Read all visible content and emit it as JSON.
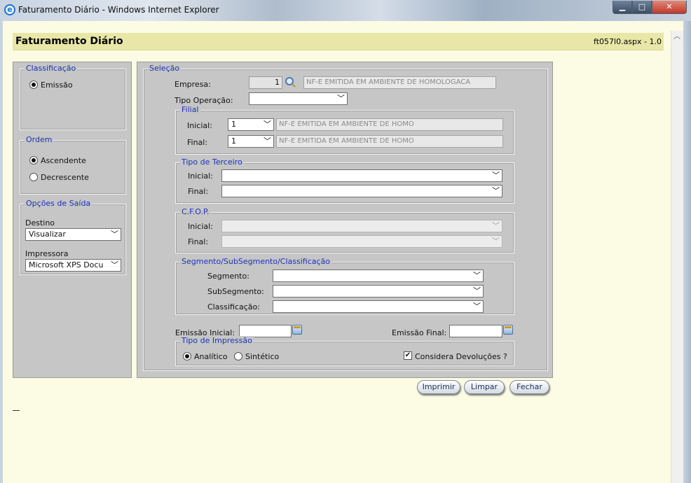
{
  "window": {
    "title": "Faturamento Diário - Windows Internet Explorer",
    "minimize": "▁",
    "maximize": "□",
    "close": "✕"
  },
  "header": {
    "title": "Faturamento Diário",
    "version": "ft057l0.aspx - 1.0"
  },
  "classificacao": {
    "legend": "Classificação",
    "option": "Emissão"
  },
  "ordem": {
    "legend": "Ordem",
    "asc": "Ascendente",
    "desc": "Decrescente"
  },
  "saida": {
    "legend": "Opções de Saída",
    "destino_label": "Destino",
    "destino_value": "Visualizar",
    "impressora_label": "Impressora",
    "impressora_value": "Microsoft XPS Docu"
  },
  "selecao": {
    "legend": "Seleção",
    "empresa_label": "Empresa:",
    "empresa_value": "1",
    "empresa_desc": "NF-E EMITIDA EM AMBIENTE DE HOMOLOGACA",
    "tipo_operacao_label": "Tipo Operação:",
    "tipo_operacao_value": ""
  },
  "filial": {
    "legend": "Filial",
    "inicial_label": "Inicial:",
    "inicial_value": "1",
    "inicial_desc": "NF-E EMITIDA EM AMBIENTE DE HOMO",
    "final_label": "Final:",
    "final_value": "1",
    "final_desc": "NF-E EMITIDA EM AMBIENTE DE HOMO"
  },
  "terceiro": {
    "legend": "Tipo de Terceiro",
    "inicial_label": "Inicial:",
    "final_label": "Final:"
  },
  "cfop": {
    "legend": "C.F.O.P.",
    "inicial_label": "Inicial:",
    "final_label": "Final:"
  },
  "segmento": {
    "legend": "Segmento/SubSegmento/Classificação",
    "segmento_label": "Segmento:",
    "subsegmento_label": "SubSegmento:",
    "classificacao_label": "Classificação:"
  },
  "emissao": {
    "inicial_label": "Emissão Inicial:",
    "final_label": "Emissão Final:"
  },
  "impressao": {
    "legend": "Tipo de Impressão",
    "analitico": "Analítico",
    "sintetico": "Sintético",
    "devolucoes": "Considera Devoluções ?"
  },
  "buttons": {
    "imprimir": "Imprimir",
    "limpar": "Limpar",
    "fechar": "Fechar"
  }
}
